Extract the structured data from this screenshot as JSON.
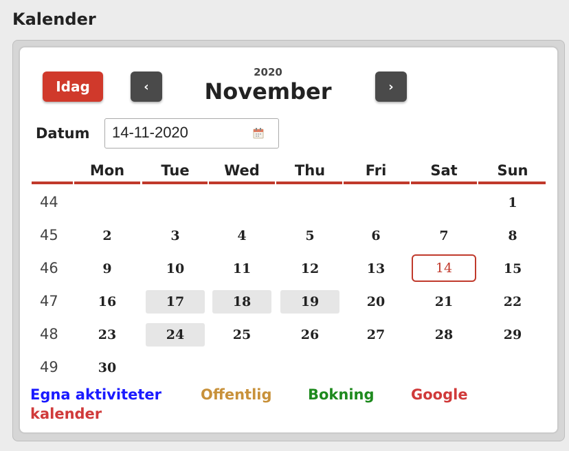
{
  "page": {
    "title": "Kalender"
  },
  "toolbar": {
    "today_label": "Idag",
    "prev_label": "‹",
    "next_label": "›",
    "year": "2020",
    "month": "November"
  },
  "date_picker": {
    "label": "Datum",
    "value": "14-11-2020",
    "icon": "calendar-icon"
  },
  "calendar": {
    "weekdays": [
      "Mon",
      "Tue",
      "Wed",
      "Thu",
      "Fri",
      "Sat",
      "Sun"
    ],
    "weeks": [
      {
        "week": "44",
        "days": [
          "",
          "",
          "",
          "",
          "",
          "",
          "1"
        ]
      },
      {
        "week": "45",
        "days": [
          "2",
          "3",
          "4",
          "5",
          "6",
          "7",
          "8"
        ]
      },
      {
        "week": "46",
        "days": [
          "9",
          "10",
          "11",
          "12",
          "13",
          "14",
          "15"
        ]
      },
      {
        "week": "47",
        "days": [
          "16",
          "17",
          "18",
          "19",
          "20",
          "21",
          "22"
        ]
      },
      {
        "week": "48",
        "days": [
          "23",
          "24",
          "25",
          "26",
          "27",
          "28",
          "29"
        ]
      },
      {
        "week": "49",
        "days": [
          "30",
          "",
          "",
          "",
          "",
          "",
          ""
        ]
      }
    ],
    "selected_day": "14",
    "highlighted_days": [
      "17",
      "18",
      "19",
      "24"
    ]
  },
  "legend": {
    "items": [
      {
        "label": "Egna aktiviteter",
        "color": "#1a1aff"
      },
      {
        "label": "Offentlig",
        "color": "#c8913a"
      },
      {
        "label": "Bokning",
        "color": "#1e8a1e"
      },
      {
        "label": "Google",
        "color": "#d03a3a"
      }
    ],
    "sub_label": "kalender",
    "sub_color": "#d03a3a"
  },
  "colors": {
    "accent": "#d0392b",
    "nav_button": "#4a4a4a",
    "highlight_bg": "#e6e6e6"
  }
}
